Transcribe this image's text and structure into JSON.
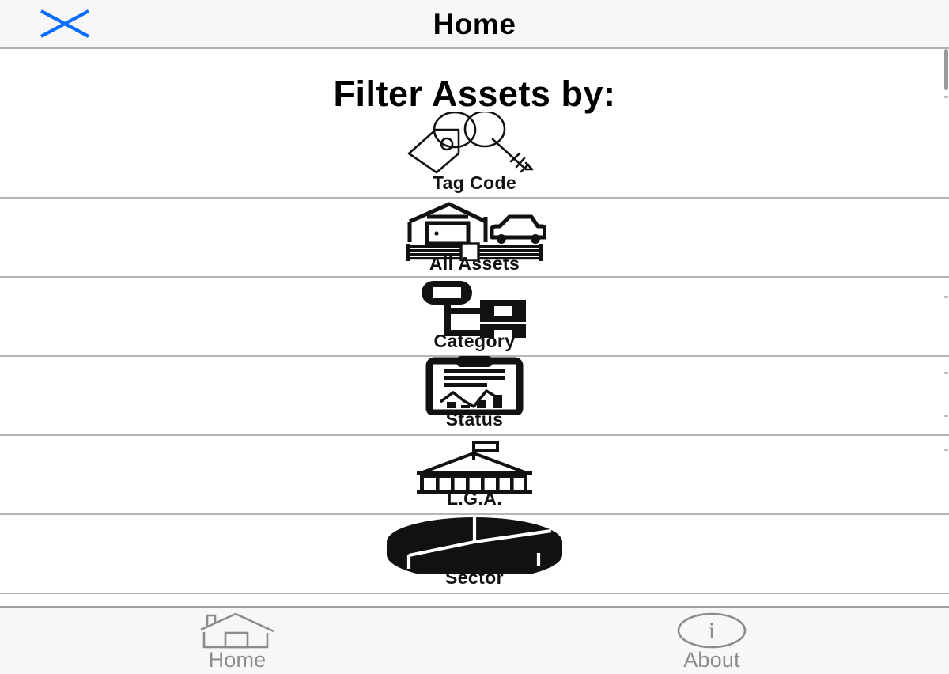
{
  "header": {
    "title": "Home",
    "close_icon": "close-x-icon",
    "accent_color": "#0a6cff",
    "background": "#f7f7f7"
  },
  "main": {
    "page_title": "Filter Assets by:",
    "filters": [
      {
        "label": "Tag Code",
        "icon": "tag-key-icon"
      },
      {
        "label": "All Assets",
        "icon": "house-car-icon"
      },
      {
        "label": "Category",
        "icon": "hierarchy-tree-icon"
      },
      {
        "label": "Status",
        "icon": "clipboard-chart-icon"
      },
      {
        "label": "L.G.A.",
        "icon": "government-building-icon"
      },
      {
        "label": "Sector",
        "icon": "pie-chart-icon"
      }
    ]
  },
  "tabbar": {
    "background": "#f7f7f7",
    "inactive_color": "#8c8c8c",
    "tabs": [
      {
        "label": "Home",
        "icon": "house-outline-icon"
      },
      {
        "label": "About",
        "icon": "info-circle-icon"
      }
    ]
  },
  "scrollbar": {
    "thumb_color": "#9a9a9a",
    "tick_color": "#bdbdbd"
  },
  "colors": {
    "divider": "#b5b5b5",
    "icon_black": "#111111",
    "text_black": "#000000",
    "page_background": "#ffffff"
  }
}
